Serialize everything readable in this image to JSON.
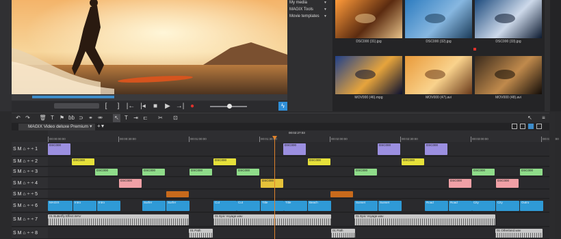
{
  "media_pool": {
    "nav": [
      {
        "label": "My media"
      },
      {
        "label": "MAGIX Tools"
      },
      {
        "label": "Movie templates"
      }
    ],
    "files": [
      {
        "name": "DSC000 (31).jpg",
        "colors": [
          "#ff9b3a",
          "#5b2b10",
          "#e7c28a"
        ]
      },
      {
        "name": "DSC000 (32).jpg",
        "colors": [
          "#2d7cc0",
          "#87b7e0",
          "#1b3c5a"
        ]
      },
      {
        "name": "DSC000 (33).jpg",
        "colors": [
          "#1e4c7e",
          "#cdd9ea",
          "#0c1a30"
        ]
      },
      {
        "name": "MOV000 (46).mpg",
        "colors": [
          "#20408a",
          "#e6a43c",
          "#0a1030"
        ]
      },
      {
        "name": "MOV000 (47).avi",
        "colors": [
          "#e99a3a",
          "#f9d28c",
          "#6a3a1a"
        ]
      },
      {
        "name": "MOV000 (48).avi",
        "colors": [
          "#3a2a1c",
          "#c08a4c",
          "#120c08"
        ]
      }
    ]
  },
  "project": {
    "tab_label": "MAGIX Video deluxe Premium",
    "cursor_time": "00:02:27:03"
  },
  "ruler_labels": [
    "00:00:00:00",
    "00:00:30:00",
    "00:01:00:00",
    "00:01:30:00",
    "00:02:00:00",
    "00:02:30:00",
    "00:03:00:00",
    "00:03:30:00"
  ],
  "tracks": [
    {
      "num": "1",
      "header": "S M ⌂ ÷ ÷ 1",
      "clips": [
        {
          "start": 0,
          "len": 33,
          "color": "#9b8fe0",
          "label": "DSC000"
        },
        {
          "start": 344,
          "len": 33,
          "color": "#9b8fe0",
          "label": "DSC000"
        },
        {
          "start": 482,
          "len": 33,
          "color": "#9b8fe0",
          "label": "DSC000"
        },
        {
          "start": 551,
          "len": 33,
          "color": "#9b8fe0",
          "label": "DSC000"
        }
      ]
    },
    {
      "num": "2",
      "header": "S M ⌂ ÷ ÷ 2",
      "clips": [
        {
          "start": 35,
          "len": 33,
          "color": "#e6e13a",
          "label": "DSC000"
        },
        {
          "start": 242,
          "len": 33,
          "color": "#e6e13a",
          "label": "DSC000"
        },
        {
          "start": 380,
          "len": 33,
          "color": "#e6e13a",
          "label": "DSC000"
        },
        {
          "start": 517,
          "len": 33,
          "color": "#e6e13a",
          "label": "DSC000"
        }
      ]
    },
    {
      "num": "3",
      "header": "S M ⌂ ÷ ÷ 3",
      "clips": [
        {
          "start": 69,
          "len": 33,
          "color": "#8fdc8a",
          "label": "DSC000"
        },
        {
          "start": 138,
          "len": 33,
          "color": "#8fdc8a",
          "label": "DSC000"
        },
        {
          "start": 207,
          "len": 33,
          "color": "#8fdc8a",
          "label": "DSC000"
        },
        {
          "start": 276,
          "len": 33,
          "color": "#8fdc8a",
          "label": "DSC000"
        },
        {
          "start": 448,
          "len": 33,
          "color": "#8fdc8a",
          "label": "DSC000"
        },
        {
          "start": 620,
          "len": 33,
          "color": "#8fdc8a",
          "label": "DSC000"
        },
        {
          "start": 690,
          "len": 33,
          "color": "#8fdc8a",
          "label": "DSC000"
        }
      ]
    },
    {
      "num": "4",
      "header": "S M ⌂ ÷ ÷ 4",
      "clips": [
        {
          "start": 104,
          "len": 33,
          "color": "#f0a0a6",
          "label": "DSC000"
        },
        {
          "start": 311,
          "len": 33,
          "color": "#e6c23a",
          "label": "DSC000"
        },
        {
          "start": 586,
          "len": 33,
          "color": "#f0a0a6",
          "label": "DSC000"
        },
        {
          "start": 655,
          "len": 33,
          "color": "#f0a0a6",
          "label": "DSC000"
        }
      ]
    },
    {
      "num": "5",
      "header": "S M ⌂ ÷ ÷ 5",
      "clips": [
        {
          "start": 173,
          "len": 33,
          "color": "#c86a1c",
          "label": ""
        },
        {
          "start": 413,
          "len": 33,
          "color": "#c86a1c",
          "label": ""
        }
      ]
    },
    {
      "num": "6",
      "header": "S M ⌂ ÷ ÷ 6",
      "clips": [
        {
          "start": 0,
          "len": 36,
          "color": "#2f9ad6",
          "label": "MAGIX"
        },
        {
          "start": 37,
          "len": 34,
          "color": "#2f9ad6",
          "label": "Intro"
        },
        {
          "start": 72,
          "len": 34,
          "color": "#2f9ad6",
          "label": "Intro"
        },
        {
          "start": 138,
          "len": 34,
          "color": "#2f9ad6",
          "label": "Surfer"
        },
        {
          "start": 173,
          "len": 34,
          "color": "#2f9ad6",
          "label": "Surfer"
        },
        {
          "start": 242,
          "len": 34,
          "color": "#2f9ad6",
          "label": "Cut"
        },
        {
          "start": 276,
          "len": 34,
          "color": "#2f9ad6",
          "label": "Cut"
        },
        {
          "start": 311,
          "len": 34,
          "color": "#2f9ad6",
          "label": "Title"
        },
        {
          "start": 345,
          "len": 34,
          "color": "#2f9ad6",
          "label": "Title"
        },
        {
          "start": 380,
          "len": 34,
          "color": "#2f9ad6",
          "label": "Beach"
        },
        {
          "start": 448,
          "len": 34,
          "color": "#2f9ad6",
          "label": "Sunset"
        },
        {
          "start": 483,
          "len": 34,
          "color": "#2f9ad6",
          "label": "Sunset"
        },
        {
          "start": 551,
          "len": 34,
          "color": "#2f9ad6",
          "label": "Road"
        },
        {
          "start": 586,
          "len": 34,
          "color": "#2f9ad6",
          "label": "Road"
        },
        {
          "start": 620,
          "len": 34,
          "color": "#2f9ad6",
          "label": "City"
        },
        {
          "start": 655,
          "len": 34,
          "color": "#2f9ad6",
          "label": "City"
        },
        {
          "start": 690,
          "len": 34,
          "color": "#2f9ad6",
          "label": "Outro"
        }
      ]
    },
    {
      "num": "7",
      "header": "S M ⌂ ÷ ÷ 7",
      "clips": [
        {
          "start": 0,
          "len": 206,
          "color": "#c9c9c9",
          "label": "01 Butterfly Effect.WAV"
        },
        {
          "start": 242,
          "len": 172,
          "color": "#c9c9c9",
          "label": "01 Epic Voyage.wav"
        },
        {
          "start": 448,
          "len": 206,
          "color": "#c9c9c9",
          "label": "01 Epic Voyage.wav"
        }
      ]
    },
    {
      "num": "8",
      "header": "S M ⌂ ÷ ÷ 8",
      "clips": [
        {
          "start": 206,
          "len": 35,
          "color": "#c9c9c9",
          "label": "01 Path"
        },
        {
          "start": 414,
          "len": 35,
          "color": "#c9c9c9",
          "label": "01 Path"
        },
        {
          "start": 654,
          "len": 69,
          "color": "#c9c9c9",
          "label": "01 Otherland.wav"
        }
      ]
    }
  ]
}
